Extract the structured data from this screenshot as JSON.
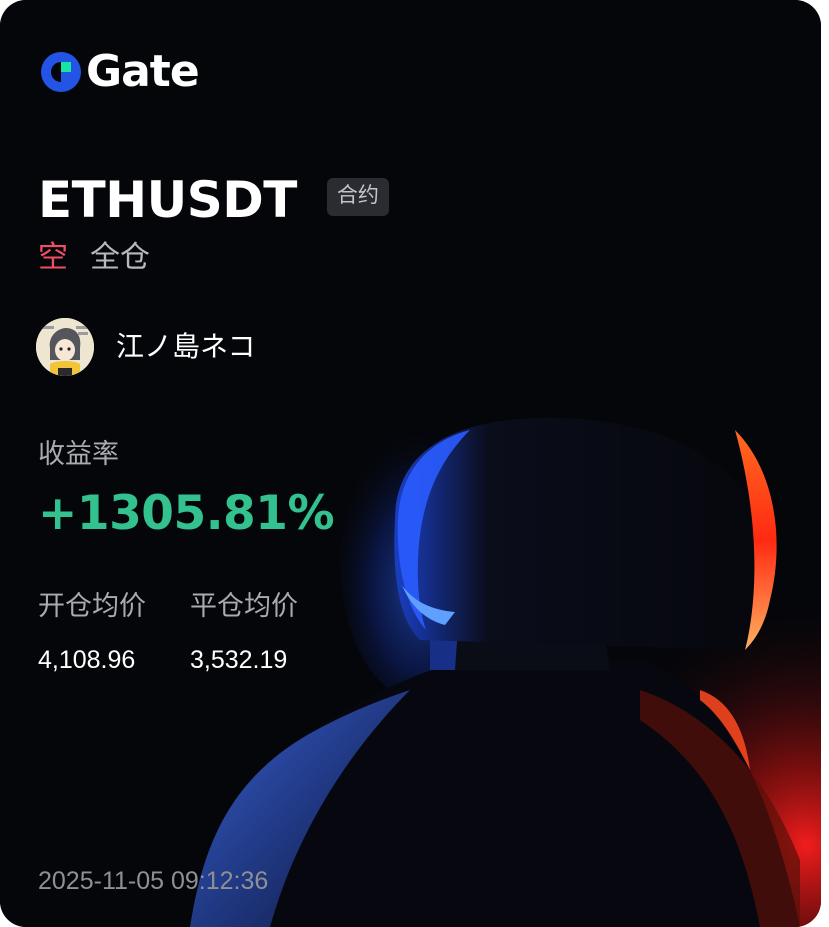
{
  "brand": {
    "name": "Gate",
    "logo_icon": "gate-logo-icon"
  },
  "position": {
    "pair": "ETHUSDT",
    "contract_badge": "合约",
    "direction": "空",
    "margin_mode": "全仓"
  },
  "user": {
    "name": "江ノ島ネコ",
    "avatar_icon": "avatar-image"
  },
  "roi": {
    "label": "收益率",
    "value": "+1305.81%"
  },
  "prices": {
    "open_label": "开仓均价",
    "open_value": "4,108.96",
    "close_label": "平仓均价",
    "close_value": "3,532.19"
  },
  "timestamp": "2025-11-05 09:12:36",
  "colors": {
    "background": "#05060a",
    "profit_green": "#33c28f",
    "short_red": "#ef4f62",
    "brand_blue": "#2354e6",
    "brand_green": "#17e5a1"
  }
}
